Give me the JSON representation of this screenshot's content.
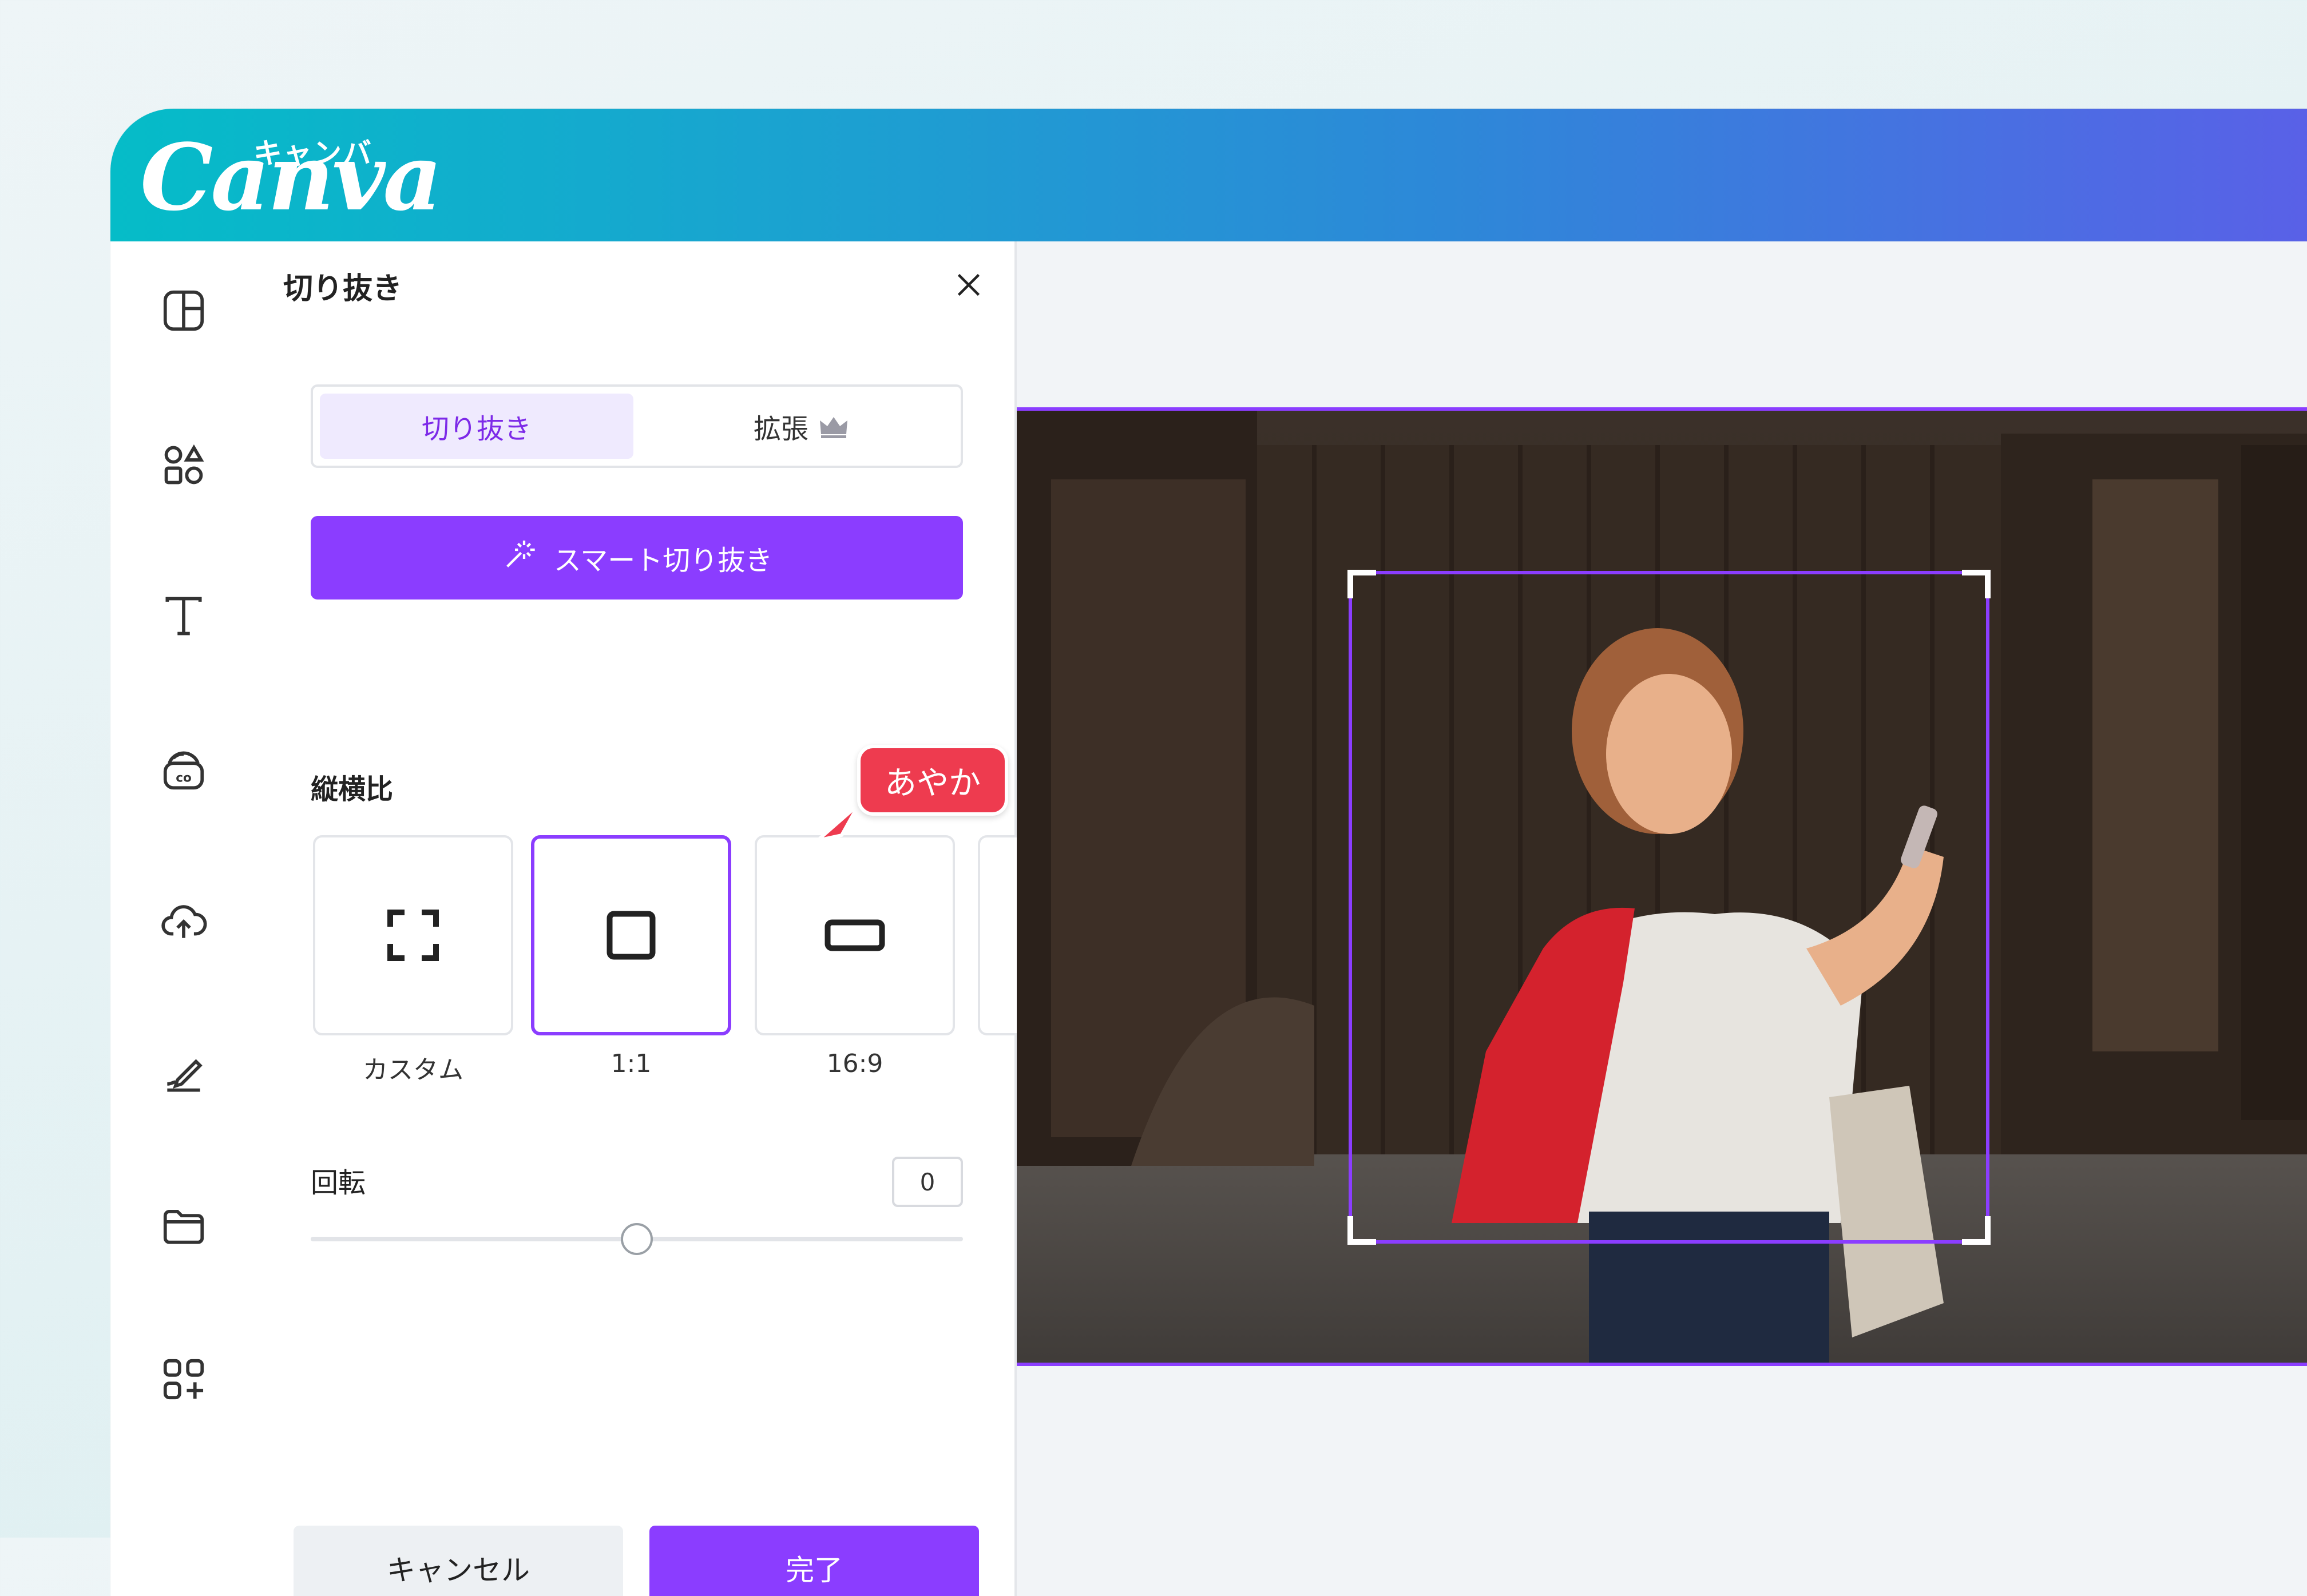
{
  "app": {
    "logo_main": "Canva",
    "logo_kana": "キャンバ"
  },
  "sidebar": {
    "items": [
      {
        "icon": "layout-icon"
      },
      {
        "icon": "elements-icon"
      },
      {
        "icon": "text-icon"
      },
      {
        "icon": "brand-icon"
      },
      {
        "icon": "upload-cloud-icon"
      },
      {
        "icon": "draw-icon"
      },
      {
        "icon": "folder-icon"
      },
      {
        "icon": "apps-icon"
      }
    ]
  },
  "panel": {
    "title": "切り抜き",
    "tabs": {
      "crop": "切り抜き",
      "expand": "拡張"
    },
    "smart_crop": "スマート切り抜き",
    "aspect_ratio_label": "縦横比",
    "ratios": [
      {
        "label": "カスタム",
        "selected": false
      },
      {
        "label": "1:1",
        "selected": true
      },
      {
        "label": "16:9",
        "selected": false
      }
    ],
    "rotation": {
      "label": "回転",
      "value": "0",
      "slider_fraction": 0.5
    },
    "buttons": {
      "cancel": "キャンセル",
      "done": "完了"
    }
  },
  "collaborator": {
    "name": "あやか",
    "color": "#ee3b4f"
  },
  "colors": {
    "accent": "#8b3dff",
    "accent_light": "#efeafe"
  }
}
